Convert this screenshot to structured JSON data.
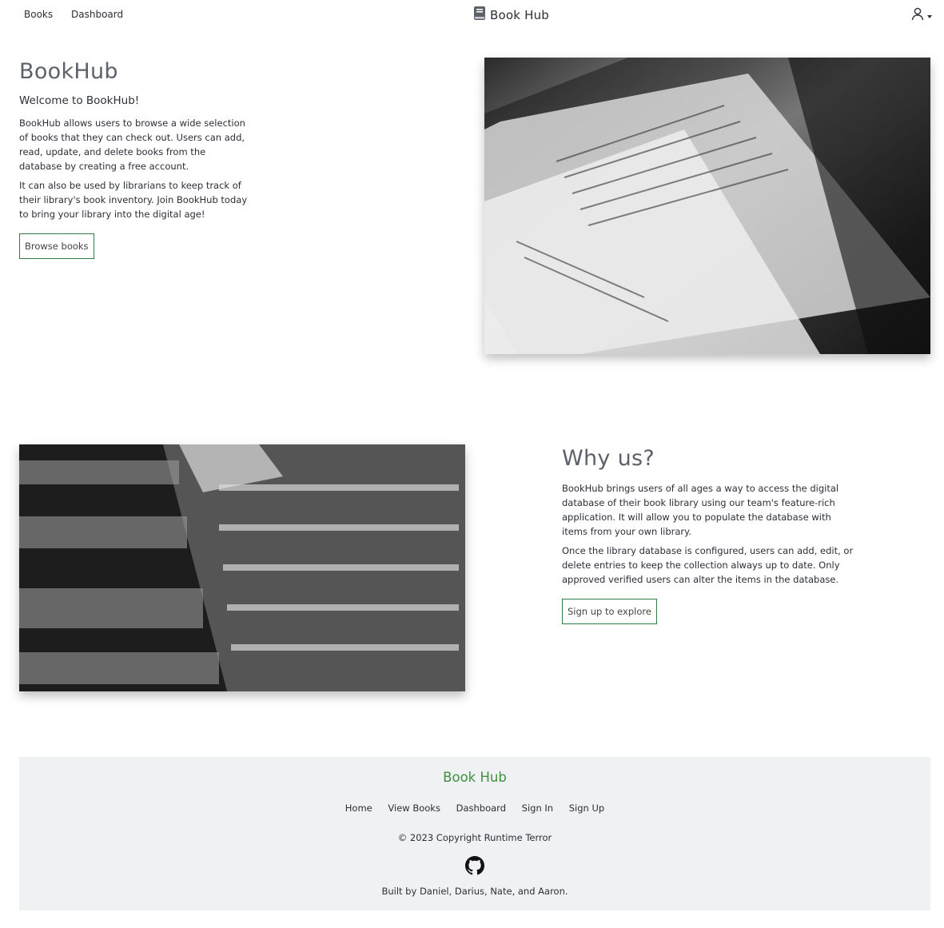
{
  "nav": {
    "links": [
      "Books",
      "Dashboard"
    ],
    "brand": "Book Hub"
  },
  "hero": {
    "title": "BookHub",
    "lead": "Welcome to BookHub!",
    "p1": "BookHub allows users to browse a wide selection of books that they can check out. Users can add, read, update, and delete books from the database by creating a free account.",
    "p2": "It can also be used by librarians to keep track of their library's book inventory. Join BookHub today to bring your library into the digital age!",
    "button": "Browse books"
  },
  "why": {
    "title": "Why us?",
    "p1": "BookHub brings users of all ages a way to access the digital database of their book library using our team's feature-rich application. It will allow you to populate the database with items from your own library.",
    "p2": "Once the library database is configured, users can add, edit, or delete entries to keep the collection always up to date. Only approved verified users can alter the items in the database.",
    "button": "Sign up to explore"
  },
  "footer": {
    "brand": "Book Hub",
    "links": [
      "Home",
      "View Books",
      "Dashboard",
      "Sign In",
      "Sign Up"
    ],
    "copyright": "© 2023 Copyright Runtime Terror",
    "built_by": "Built by Daniel, Darius, Nate, and Aaron."
  },
  "icons": {
    "brand": "book-icon",
    "user": "user-icon",
    "github": "github-icon"
  },
  "colors": {
    "accent_green": "#3f8f3f",
    "button_border": "#2e7d45",
    "footer_bg": "#f0f1f3"
  }
}
